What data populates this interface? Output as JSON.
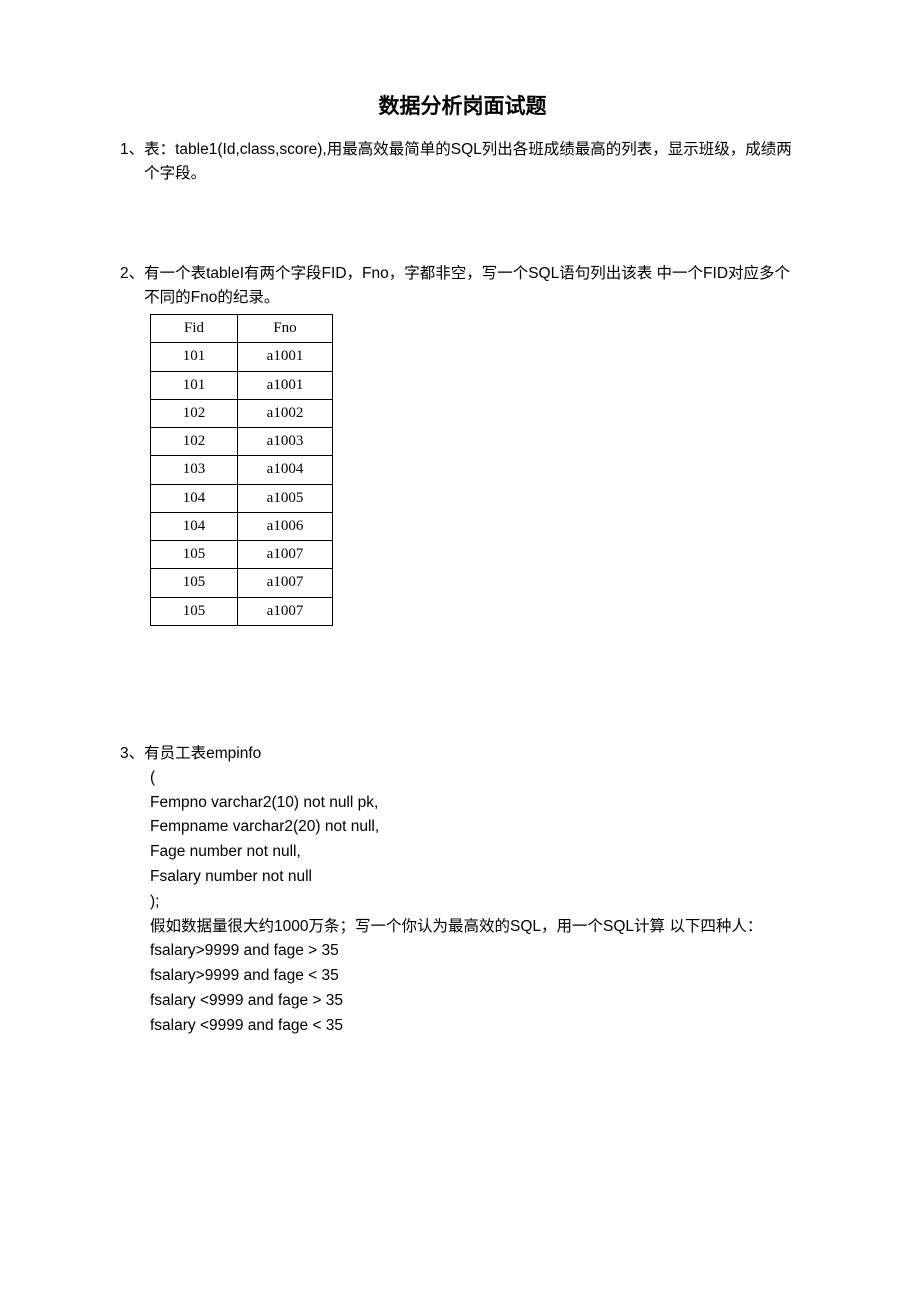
{
  "title": "数据分析岗面试题",
  "q1": {
    "num": "1、",
    "text": "表：table1(Id,class,score),用最高效最简单的SQL列出各班成绩最高的列表，显示班级，成绩两个字段。"
  },
  "q2": {
    "num": "2、",
    "text": "有一个表tableI有两个字段FID，Fno，字都非空，写一个SQL语句列出该表 中一个FID对应多个不同的Fno的纪录。",
    "headers": [
      "Fid",
      "Fno"
    ],
    "rows": [
      [
        "101",
        "a1001"
      ],
      [
        "101",
        "a1001"
      ],
      [
        "102",
        "a1002"
      ],
      [
        "102",
        "a1003"
      ],
      [
        "103",
        "a1004"
      ],
      [
        "104",
        "a1005"
      ],
      [
        "104",
        "a1006"
      ],
      [
        "105",
        "a1007"
      ],
      [
        "105",
        "a1007"
      ],
      [
        "105",
        "a1007"
      ]
    ]
  },
  "q3": {
    "num": "3、",
    "lead": "有员工表empinfo",
    "lines": [
      "(",
      "Fempno varchar2(10) not null pk,",
      "Fempname varchar2(20) not null,",
      "Fage number not null,",
      "Fsalary number not null",
      ");",
      "假如数据量很大约1000万条；写一个你认为最高效的SQL，用一个SQL计算 以下四种人：",
      "fsalary>9999 and fage > 35",
      "fsalary>9999 and fage < 35",
      "fsalary <9999 and fage > 35",
      "fsalary <9999 and fage < 35"
    ]
  }
}
